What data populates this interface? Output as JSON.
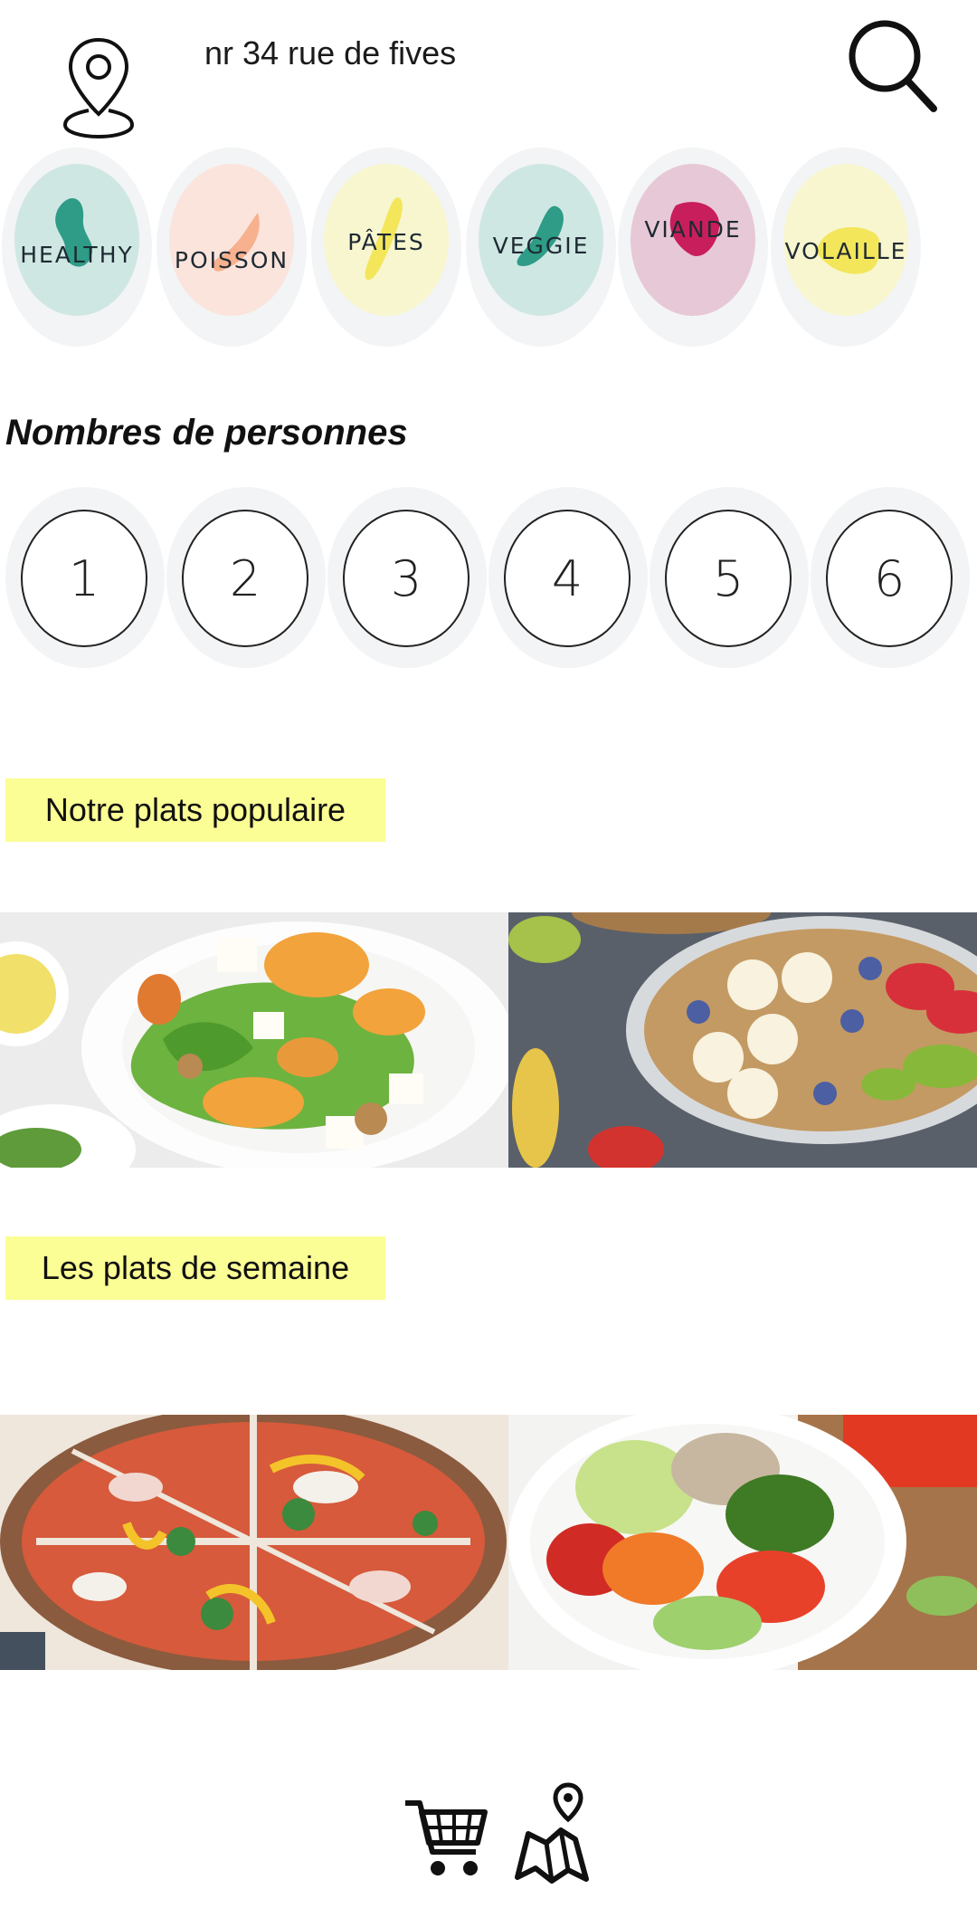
{
  "header": {
    "address": "nr 34 rue de fives"
  },
  "categories": [
    {
      "label": "HEALTHY",
      "bg": "#cfe7e3",
      "blob": "#2e9c86"
    },
    {
      "label": "POISSON",
      "bg": "#fbe4dc",
      "blob": "#f7b18e"
    },
    {
      "label": "PÂTES",
      "bg": "#f8f6cf",
      "blob": "#f3e65b"
    },
    {
      "label": "VEGGIE",
      "bg": "#cfe7e3",
      "blob": "#2e9c86"
    },
    {
      "label": "VIANDE",
      "bg": "#e7c8d6",
      "blob": "#c81e5b"
    },
    {
      "label": "VOLAILLE",
      "bg": "#f8f6cf",
      "blob": "#f3e65b"
    }
  ],
  "persons": {
    "title": "Nombres de personnes",
    "options": [
      "1",
      "2",
      "3",
      "4",
      "5",
      "6"
    ]
  },
  "popular": {
    "title": "Notre plats populaire"
  },
  "weekly": {
    "title": "Les plats de semaine"
  },
  "colors": {
    "tag_bg": "#fbfd95",
    "circle_bg": "#f3f4f5"
  }
}
